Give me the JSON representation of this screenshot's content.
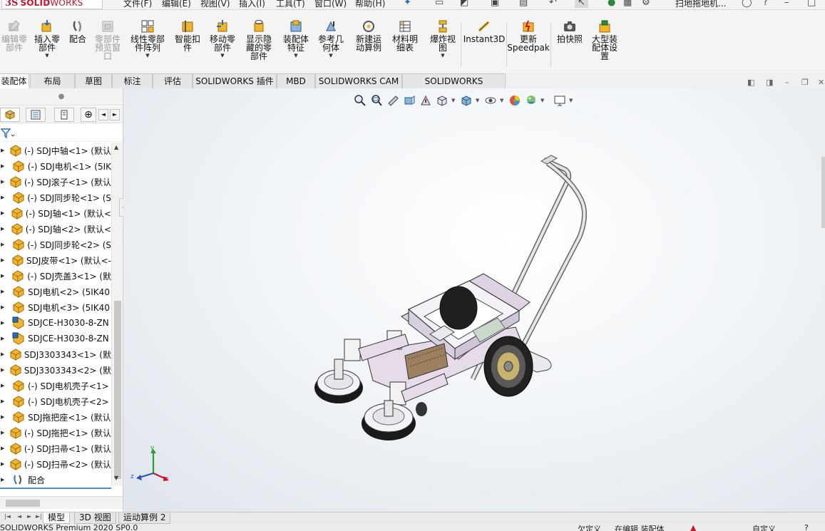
{
  "app": {
    "logo_ds": "3S",
    "logo_brand": "SOLID",
    "logo_works": "WORKS",
    "doc_name": "扫地拖地机..."
  },
  "menu": [
    "文件(F)",
    "编辑(E)",
    "视图(V)",
    "插入(I)",
    "工具(T)",
    "窗口(W)",
    "帮助(H)"
  ],
  "commands": [
    {
      "label": "编辑零\n部件",
      "icon": "edit-component-icon",
      "disabled": true
    },
    {
      "label": "插入零\n部件",
      "icon": "insert-component-icon",
      "dropdown": true
    },
    {
      "label": "配合",
      "icon": "mate-icon"
    },
    {
      "label": "零部件\n预览窗\n口",
      "icon": "component-preview-icon",
      "disabled": true
    },
    {
      "label": "线性零部\n件阵列",
      "icon": "linear-pattern-icon",
      "dropdown": true
    },
    {
      "label": "智能扣\n件",
      "icon": "smart-fastener-icon"
    },
    {
      "label": "移动零\n部件",
      "icon": "move-component-icon",
      "dropdown": true
    },
    {
      "label": "显示隐\n藏的零\n部件",
      "icon": "show-hidden-icon"
    },
    {
      "label": "装配体\n特征",
      "icon": "assembly-feature-icon",
      "dropdown": true
    },
    {
      "label": "参考几\n何体",
      "icon": "reference-geometry-icon",
      "dropdown": true
    },
    {
      "label": "新建运\n动算例",
      "icon": "motion-study-icon"
    },
    {
      "label": "材料明\n细表",
      "icon": "bom-icon"
    },
    {
      "label": "爆炸视\n图",
      "icon": "exploded-view-icon",
      "dropdown": true
    },
    {
      "label": "Instant3D",
      "icon": "instant3d-icon"
    },
    {
      "label": "更新\nSpeedpak",
      "icon": "speedpak-icon"
    },
    {
      "label": "拍快照",
      "icon": "snapshot-icon"
    },
    {
      "label": "大型装\n配体设\n置",
      "icon": "large-assembly-icon"
    }
  ],
  "tabs": [
    "装配体",
    "布局",
    "草图",
    "标注",
    "评估",
    "SOLIDWORKS 插件",
    "MBD",
    "SOLIDWORKS CAM",
    "SOLIDWORKS Inspection"
  ],
  "tree": [
    {
      "label": "(-) SDJ中轴<1> (默认",
      "type": "part"
    },
    {
      "label": "(-) SDJ电机<1> (5IK",
      "type": "part"
    },
    {
      "label": "(-) SDJ滚子<1> (默认",
      "type": "part"
    },
    {
      "label": "(-) SDJ同步轮<1> (S",
      "type": "part"
    },
    {
      "label": "(-) SDJ轴<1> (默认<",
      "type": "part"
    },
    {
      "label": "(-) SDJ轴<2> (默认<",
      "type": "part"
    },
    {
      "label": "(-) SDJ同步轮<2> (S",
      "type": "part"
    },
    {
      "label": "SDJ皮带<1> (默认<-",
      "type": "part"
    },
    {
      "label": "(-) SDJ壳盖3<1> (默",
      "type": "part"
    },
    {
      "label": "SDJ电机<2> (5IK40",
      "type": "part"
    },
    {
      "label": "SDJ电机<3> (5IK40",
      "type": "part"
    },
    {
      "label": "SDJCE-H3030-8-ZN",
      "type": "toolbox"
    },
    {
      "label": "SDJCE-H3030-8-ZN",
      "type": "toolbox"
    },
    {
      "label": "SDJ3303343<1> (默",
      "type": "part"
    },
    {
      "label": "SDJ3303343<2> (默",
      "type": "part"
    },
    {
      "label": "(-) SDJ电机壳子<1>",
      "type": "part"
    },
    {
      "label": "(-) SDJ电机壳子<2>",
      "type": "part"
    },
    {
      "label": "SDJ拖把座<1> (默认",
      "type": "part"
    },
    {
      "label": "(-) SDJ拖把<1> (默认",
      "type": "part"
    },
    {
      "label": "(-) SDJ扫帚<1> (默认",
      "type": "part"
    },
    {
      "label": "(-) SDJ扫帚<2> (默认",
      "type": "part"
    },
    {
      "label": "配合",
      "type": "mates"
    }
  ],
  "triad": {
    "x": "x",
    "y": "y",
    "z": "z"
  },
  "bottom_tabs": [
    "模型",
    "3D 视图",
    "运动算例 2"
  ],
  "status": {
    "left": "SOLIDWORKS Premium 2020 SP0.0",
    "mid1": "欠定义",
    "mid2": "在编辑 装配体",
    "right": "自定义"
  },
  "colors": {
    "accent": "#4a90c8",
    "logo_red": "#d0112b",
    "part_yellow": "#f2b42a",
    "viewport_bg": "#e8edf2"
  }
}
